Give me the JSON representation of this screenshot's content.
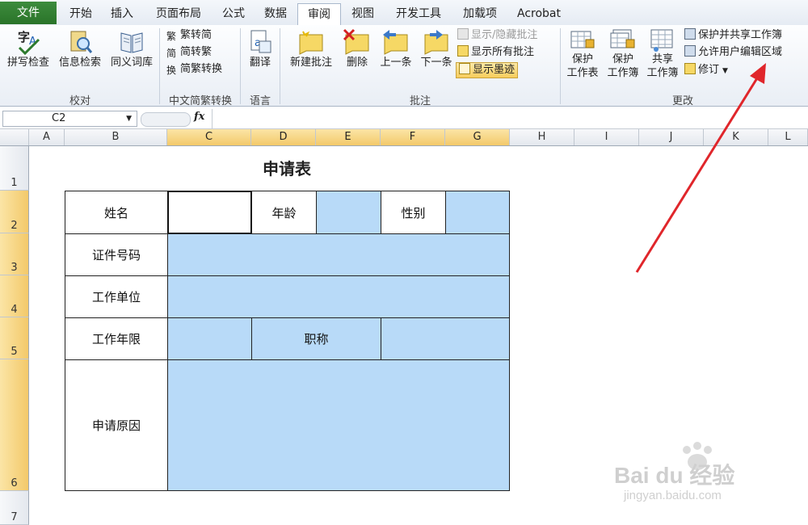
{
  "tabs": [
    "文件",
    "开始",
    "插入",
    "页面布局",
    "公式",
    "数据",
    "审阅",
    "视图",
    "开发工具",
    "加载项",
    "Acrobat"
  ],
  "active_tab": "审阅",
  "ribbon": {
    "proofing": {
      "spell": "拼写检查",
      "research": "信息检索",
      "thesaurus": "同义词库",
      "label": "校对"
    },
    "chinese": {
      "t2s": "繁转简",
      "s2t": "简转繁",
      "convert": "简繁转换",
      "label": "中文简繁转换"
    },
    "language": {
      "translate": "翻译",
      "label": "语言"
    },
    "comments": {
      "new": "新建批注",
      "delete": "删除",
      "prev": "上一条",
      "next": "下一条",
      "show_hide": "显示/隐藏批注",
      "show_all": "显示所有批注",
      "show_ink": "显示墨迹",
      "label": "批注"
    },
    "changes": {
      "protect_sheet": [
        "保护",
        "工作表"
      ],
      "protect_book": [
        "保护",
        "工作簿"
      ],
      "share_book": [
        "共享",
        "工作簿"
      ],
      "protect_share": "保护并共享工作簿",
      "allow_edit": "允许用户编辑区域",
      "track": "修订",
      "label": "更改"
    }
  },
  "formula_bar": {
    "name_box": "C2",
    "fx": "fx",
    "value": ""
  },
  "columns": [
    "A",
    "B",
    "C",
    "D",
    "E",
    "F",
    "G",
    "H",
    "I",
    "J",
    "K",
    "L"
  ],
  "rows": [
    "1",
    "2",
    "3",
    "4",
    "5",
    "6",
    "7"
  ],
  "form": {
    "title": "申请表",
    "name": "姓名",
    "age": "年龄",
    "gender": "性别",
    "id_no": "证件号码",
    "employer": "工作单位",
    "years": "工作年限",
    "job_title": "职称",
    "reason": "申请原因"
  },
  "colors": {
    "accent": "#2a7429",
    "selection": "#f3c96a",
    "fill": "#b8daf8",
    "arrow": "#e0262b"
  },
  "watermark": {
    "brand": "Bai du 经验",
    "url": "jingyan.baidu.com"
  }
}
